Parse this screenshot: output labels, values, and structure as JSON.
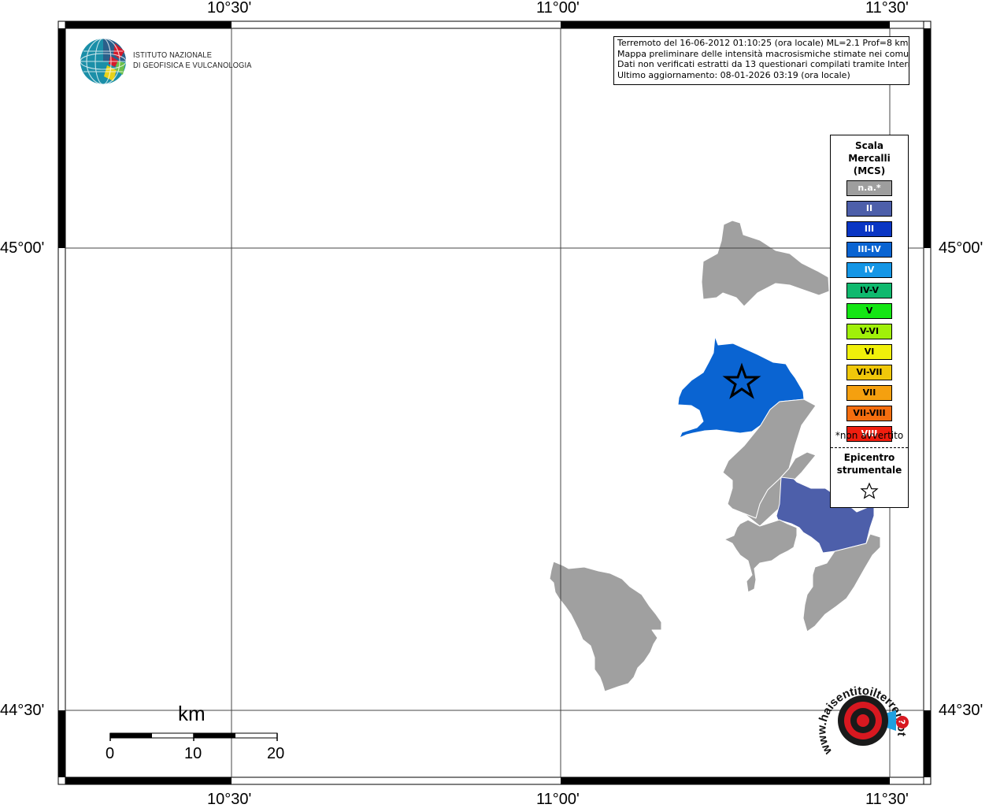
{
  "info": {
    "line1": "Terremoto del 16-06-2012 01:10:25 (ora locale) ML=2.1 Prof=8 km",
    "line2": "Mappa preliminare delle intensità macrosismiche stimate nei comuni",
    "line3": "Dati non verificati estratti da 13 questionari compilati tramite Internet.",
    "line4": "Ultimo aggiornamento: 08-01-2026 03:19 (ora locale)"
  },
  "coords": {
    "lon_1030": "10°30'",
    "lon_1100": "11°00'",
    "lon_1130": "11°30'",
    "lat_4500": "45°00'",
    "lat_4430": "44°30'"
  },
  "logo": {
    "line1": "ISTITUTO NAZIONALE",
    "line2": "DI GEOFISICA E VULCANOLOGIA"
  },
  "legend": {
    "title": [
      "Scala",
      "Mercalli",
      "(MCS)"
    ],
    "items": [
      {
        "label": "n.a.*",
        "color": "#9e9e9e",
        "text_color": "#ffffff"
      },
      {
        "label": "II",
        "color": "#4d5faa",
        "text_color": "#ffffff"
      },
      {
        "label": "III",
        "color": "#0a36c4",
        "text_color": "#ffffff"
      },
      {
        "label": "III-IV",
        "color": "#0a64d2",
        "text_color": "#ffffff"
      },
      {
        "label": "IV",
        "color": "#1496e6",
        "text_color": "#ffffff"
      },
      {
        "label": "IV-V",
        "color": "#0fb96e",
        "text_color": "#000000"
      },
      {
        "label": "V",
        "color": "#14e614",
        "text_color": "#000000"
      },
      {
        "label": "V-VI",
        "color": "#a0f00a",
        "text_color": "#000000"
      },
      {
        "label": "VI",
        "color": "#f0f00a",
        "text_color": "#000000"
      },
      {
        "label": "VI-VII",
        "color": "#f0c80a",
        "text_color": "#000000"
      },
      {
        "label": "VII",
        "color": "#f5a00f",
        "text_color": "#000000"
      },
      {
        "label": "VII-VIII",
        "color": "#f56e0f",
        "text_color": "#000000"
      },
      {
        "label": "VIII",
        "color": "#f01e0f",
        "text_color": "#ffffff"
      }
    ],
    "note": "*non avvertito",
    "epicenter_line1": "Epicentro",
    "epicenter_line2": "strumentale"
  },
  "scalebar": {
    "unit": "km",
    "ticks": [
      "0",
      "10",
      "20"
    ]
  },
  "hst_logo": {
    "text": "www.haisentitoilterremoto.it"
  },
  "colors": {
    "not_felt": "#a0a0a0",
    "intensity_II": "#4d5faa",
    "intensity_III_IV": "#0a64d2"
  }
}
